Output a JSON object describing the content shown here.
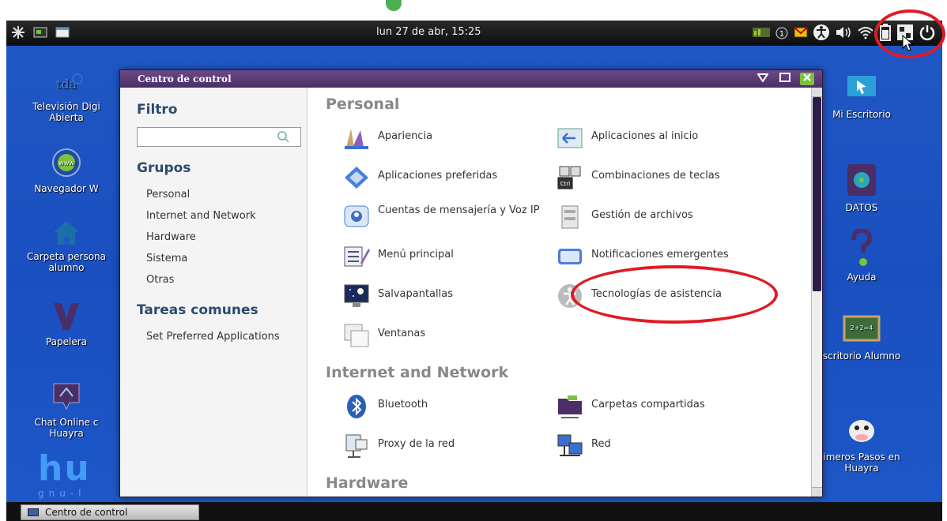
{
  "top_panel": {
    "clock": "lun 27 de abr, 15:25"
  },
  "window": {
    "title": "Centro de control",
    "sidebar": {
      "filter_heading": "Filtro",
      "filter_value": "",
      "groups_heading": "Grupos",
      "groups": [
        "Personal",
        "Internet and Network",
        "Hardware",
        "Sistema",
        "Otras"
      ],
      "tasks_heading": "Tareas comunes",
      "tasks": [
        "Set Preferred Applications"
      ]
    },
    "sections": {
      "personal": {
        "heading": "Personal",
        "items": [
          "Apariencia",
          "Aplicaciones al inicio",
          "Aplicaciones preferidas",
          "Combinaciones de teclas",
          "Cuentas de mensajería y Voz IP",
          "Gestión de archivos",
          "Menú principal",
          "Notificaciones emergentes",
          "Salvapantallas",
          "Tecnologías de asistencia",
          "Ventanas"
        ]
      },
      "internet": {
        "heading": "Internet and Network",
        "items": [
          "Bluetooth",
          "Carpetas compartidas",
          "Proxy de la red",
          "Red"
        ]
      },
      "hardware": {
        "heading": "Hardware"
      }
    }
  },
  "desktop": {
    "icons_left": [
      "Televisión Digi Abierta",
      "Navegador W",
      "Carpeta persona alumno",
      "Papelera",
      "Chat Online c Huayra"
    ],
    "icons_right": [
      "Mi Escritorio",
      "DATOS",
      "Ayuda",
      "scritorio Alumno",
      "imeros Pasos en Huayra"
    ],
    "logo_text": "hu",
    "logo_sub": "gnu-l"
  },
  "taskbar": {
    "active_task": "Centro de control"
  },
  "colors": {
    "desktop_bg": "#1a4fbf",
    "titlebar": "#4b2e66",
    "highlight_ellipse": "#e01b24"
  }
}
